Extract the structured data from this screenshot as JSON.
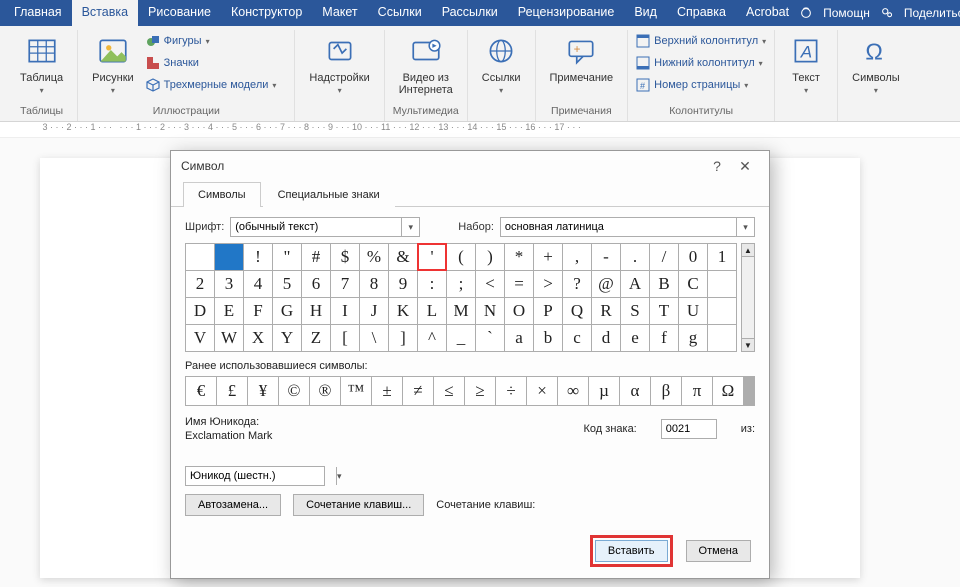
{
  "menu": {
    "tabs": [
      "Главная",
      "Вставка",
      "Рисование",
      "Конструктор",
      "Макет",
      "Ссылки",
      "Рассылки",
      "Рецензирование",
      "Вид",
      "Справка",
      "Acrobat"
    ],
    "active_index": 1,
    "help": "Помощн",
    "share": "Поделиться"
  },
  "ribbon": {
    "tables": {
      "btn": "Таблица",
      "group": "Таблицы"
    },
    "illus": {
      "pic": "Рисунки",
      "shapes": "Фигуры",
      "icons": "Значки",
      "models": "Трехмерные модели",
      "group": "Иллюстрации"
    },
    "addins": {
      "btn": "Надстройки"
    },
    "media": {
      "video": "Видео из\nИнтернета",
      "group": "Мультимедиа"
    },
    "links": {
      "btn": "Ссылки"
    },
    "notes": {
      "btn": "Примечание",
      "group": "Примечания"
    },
    "headers": {
      "top": "Верхний колонтитул",
      "bottom": "Нижний колонтитул",
      "page": "Номер страницы",
      "group": "Колонтитулы"
    },
    "text": {
      "btn": "Текст"
    },
    "sym": {
      "btn": "Символы"
    }
  },
  "ruler": " 3 · · · 2 · · · 1 · · ·   · · · 1 · · · 2 · · · 3 · · · 4 · · · 5 · · · 6 · · · 7 · · · 8 · · · 9 · · · 10 · · · 11 · · · 12 · · · 13 · · · 14 · · · 15 · · · 16 · · · 17 · · ·",
  "dlg": {
    "title": "Символ",
    "tab1": "Символы",
    "tab2": "Специальные знаки",
    "font_label": "Шрифт:",
    "font_value": "(обычный текст)",
    "set_label": "Набор:",
    "set_value": "основная латиница",
    "grid": [
      [
        "",
        "!",
        "\"",
        "#",
        "$",
        "%",
        "&",
        "'",
        "(",
        ")",
        "*",
        "+",
        ",",
        "-",
        ".",
        "/",
        "0",
        "1"
      ],
      [
        "2",
        "3",
        "4",
        "5",
        "6",
        "7",
        "8",
        "9",
        ":",
        ";",
        "<",
        "=",
        ">",
        "?",
        "@",
        "A",
        "B",
        "C"
      ],
      [
        "D",
        "E",
        "F",
        "G",
        "H",
        "I",
        "J",
        "K",
        "L",
        "M",
        "N",
        "O",
        "P",
        "Q",
        "R",
        "S",
        "T",
        "U"
      ],
      [
        "V",
        "W",
        "X",
        "Y",
        "Z",
        "[",
        "\\",
        "]",
        "^",
        "_",
        "`",
        "a",
        "b",
        "c",
        "d",
        "e",
        "f",
        "g"
      ]
    ],
    "selected_index": 1,
    "highlight_index": 7,
    "recent_label": "Ранее использовавшиеся символы:",
    "recent": [
      "€",
      "£",
      "¥",
      "©",
      "®",
      "™",
      "±",
      "≠",
      "≤",
      "≥",
      "÷",
      "×",
      "∞",
      "µ",
      "α",
      "β",
      "π",
      "Ω"
    ],
    "uni_label": "Имя Юникода:",
    "uni_name": "Exclamation Mark",
    "code_label": "Код знака:",
    "code_value": "0021",
    "from_label": "из:",
    "from_value": "Юникод (шестн.)",
    "autocorrect": "Автозамена...",
    "shortcut_btn": "Сочетание клавиш...",
    "shortcut_lbl": "Сочетание клавиш:",
    "insert": "Вставить",
    "cancel": "Отмена"
  }
}
